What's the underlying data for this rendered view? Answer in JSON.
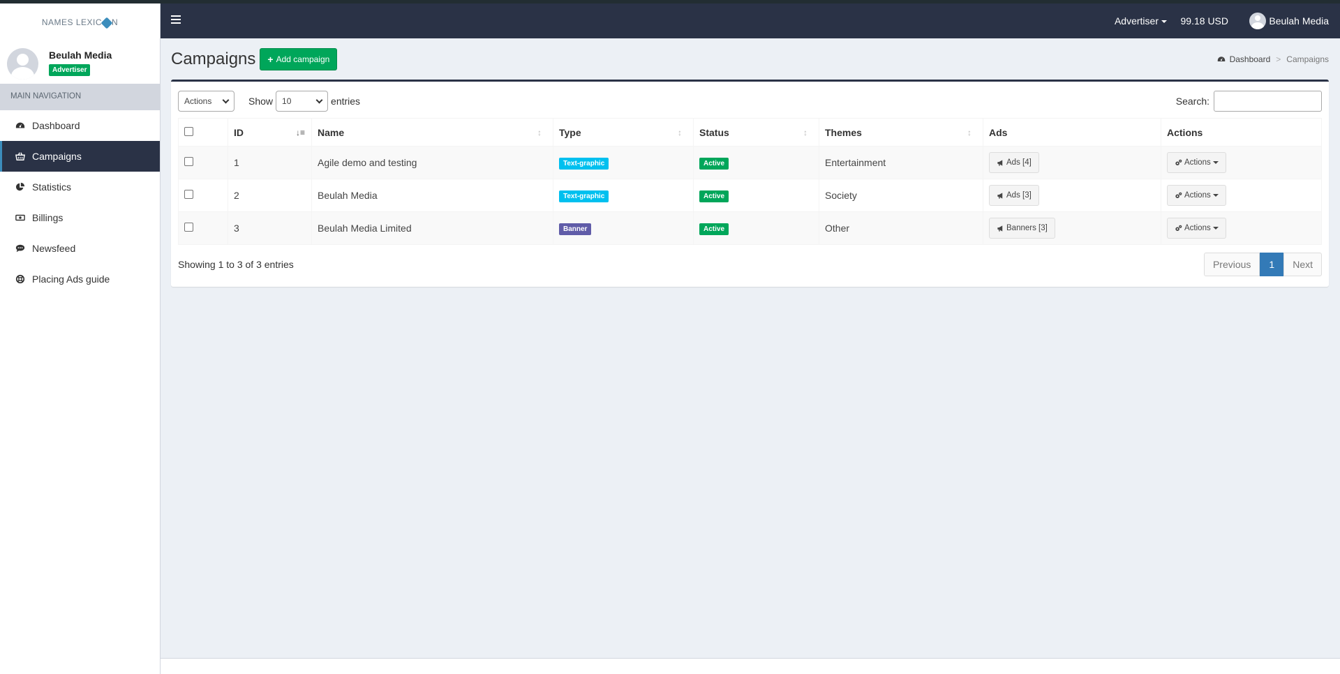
{
  "brand": {
    "logo_left": "NAMES LEXIC",
    "logo_right": "N"
  },
  "user": {
    "name": "Beulah Media",
    "role": "Advertiser"
  },
  "nav": {
    "header": "MAIN NAVIGATION",
    "items": [
      {
        "label": "Dashboard",
        "icon": "dashboard-icon"
      },
      {
        "label": "Campaigns",
        "icon": "basket-icon"
      },
      {
        "label": "Statistics",
        "icon": "pie-chart-icon"
      },
      {
        "label": "Billings",
        "icon": "money-icon"
      },
      {
        "label": "Newsfeed",
        "icon": "comment-icon"
      },
      {
        "label": "Placing Ads guide",
        "icon": "life-ring-icon"
      }
    ]
  },
  "header": {
    "role": "Advertiser",
    "balance": "99.18 USD",
    "user_name": "Beulah Media"
  },
  "page": {
    "title": "Campaigns",
    "add_button": "Add campaign"
  },
  "breadcrumb": {
    "home": "Dashboard",
    "current": "Campaigns"
  },
  "toolbar": {
    "actions_select": "Actions",
    "show_label": "Show",
    "page_size": "10",
    "entries_label": "entries",
    "search_label": "Search:"
  },
  "table": {
    "columns": [
      "ID",
      "Name",
      "Type",
      "Status",
      "Themes",
      "Ads",
      "Actions"
    ],
    "rows": [
      {
        "id": "1",
        "name": "Agile demo and testing",
        "type": "Text-graphic",
        "type_color": "#00c0ef",
        "status": "Active",
        "theme": "Entertainment",
        "ads": "Ads [4]",
        "actions": "Actions"
      },
      {
        "id": "2",
        "name": "Beulah Media",
        "type": "Text-graphic",
        "type_color": "#00c0ef",
        "status": "Active",
        "theme": "Society",
        "ads": "Ads [3]",
        "actions": "Actions"
      },
      {
        "id": "3",
        "name": "Beulah Media Limited",
        "type": "Banner",
        "type_color": "#605ca8",
        "status": "Active",
        "theme": "Other",
        "ads": "Banners [3]",
        "actions": "Actions"
      }
    ]
  },
  "pagination": {
    "info": "Showing 1 to 3 of 3 entries",
    "previous": "Previous",
    "current": "1",
    "next": "Next"
  },
  "colors": {
    "primary": "#2a3246",
    "success": "#00a65a",
    "info": "#00c0ef",
    "purple": "#605ca8",
    "link": "#337ab7"
  }
}
